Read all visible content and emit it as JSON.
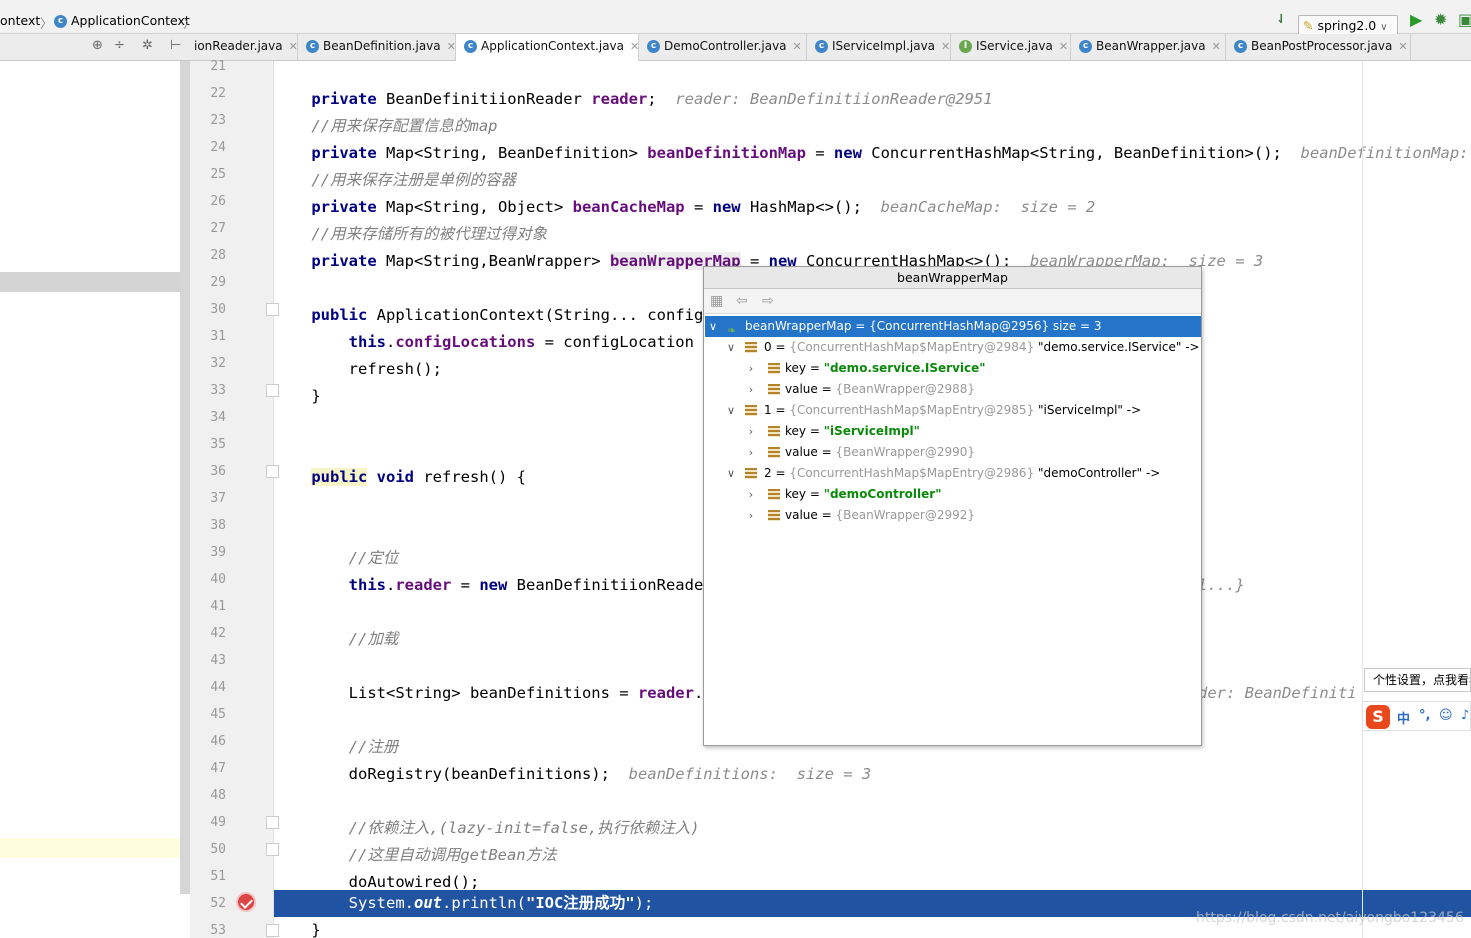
{
  "nav": {
    "crumb1": "ontext",
    "crumb2": "ApplicationContext",
    "run_config": "spring2.0"
  },
  "tabs": [
    {
      "label": "ionReader.java",
      "type": "C"
    },
    {
      "label": "BeanDefinition.java",
      "type": "C"
    },
    {
      "label": "ApplicationContext.java",
      "type": "C"
    },
    {
      "label": "DemoController.java",
      "type": "C"
    },
    {
      "label": "IServiceImpl.java",
      "type": "C"
    },
    {
      "label": "IService.java",
      "type": "I"
    },
    {
      "label": "BeanWrapper.java",
      "type": "C"
    },
    {
      "label": "BeanPostProcessor.java",
      "type": "C"
    }
  ],
  "lines": [
    "21",
    "22",
    "23",
    "24",
    "25",
    "26",
    "27",
    "28",
    "29",
    "30",
    "31",
    "32",
    "33",
    "34",
    "35",
    "36",
    "37",
    "38",
    "39",
    "40",
    "41",
    "42",
    "43",
    "44",
    "45",
    "46",
    "47",
    "48",
    "49",
    "50",
    "51",
    "52",
    "53"
  ],
  "code": {
    "l22_hint": "reader: BeanDefinitiionReader@2951",
    "l23_cmt": "//用来保存配置信息的map",
    "l24_hint": "beanDefinitionMap:",
    "l25_cmt": "//用来保存注册是单例的容器",
    "l26_hint": "beanCacheMap:  size = 2",
    "l27_cmt": "//用来存储所有的被代理过得对象",
    "l28_hint": "beanWrapperMap:  size = 3",
    "l39_cmt": "//定位",
    "l40_hint_tail": "l...}",
    "l42_cmt": "//加载",
    "l44_hint_tail": "der: BeanDefiniti",
    "l46_cmt": "//注册",
    "l47_hint": "beanDefinitions:  size = 3",
    "l49_cmt": "//依赖注入,(lazy-init=false,执行依赖注入)",
    "l50_cmt": "//这里自动调用getBean方法",
    "l52_str": "\"IOC注册成功\""
  },
  "popup": {
    "title": "beanWrapperMap",
    "root": "beanWrapperMap = {ConcurrentHashMap@2956}  size = 3",
    "entries": [
      {
        "idx": "0",
        "ref": "{ConcurrentHashMap$MapEntry@2984}",
        "desc": "\"demo.service.IService\" ->",
        "key": "\"demo.service.IService\"",
        "value": "{BeanWrapper@2988}"
      },
      {
        "idx": "1",
        "ref": "{ConcurrentHashMap$MapEntry@2985}",
        "desc": "\"iServiceImpl\" ->",
        "key": "\"iServiceImpl\"",
        "value": "{BeanWrapper@2990}"
      },
      {
        "idx": "2",
        "ref": "{ConcurrentHashMap$MapEntry@2986}",
        "desc": "\"demoController\" ->",
        "key": "\"demoController\"",
        "value": "{BeanWrapper@2992}"
      }
    ],
    "key_label": "key",
    "value_label": "value"
  },
  "ime": {
    "tip": "个性设置，点我看看",
    "logo": "S",
    "zh": "中"
  },
  "watermark": "https://blog.csdn.net/aiyongbo123456"
}
